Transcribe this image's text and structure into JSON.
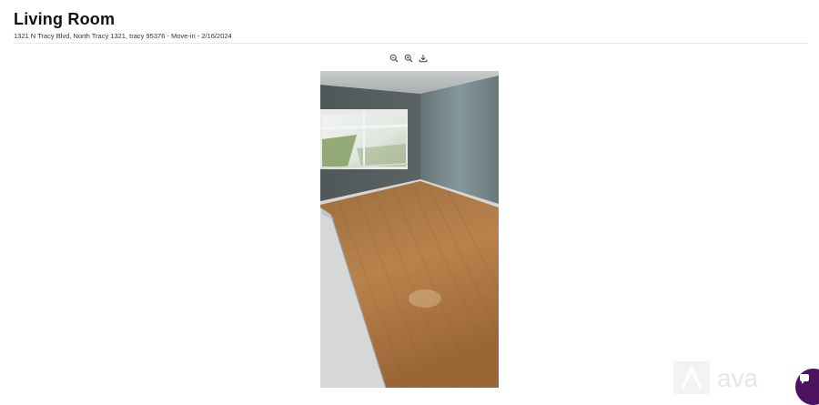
{
  "room": {
    "title": "Living Room",
    "subtitle": "1321 N Tracy Blvd, North Tracy 1321, tracy 95376 - Move-in - 2/16/2024"
  },
  "toolbar": {
    "icons": [
      "zoom-out-icon",
      "zoom-in-icon",
      "download-icon"
    ]
  },
  "photo": {
    "alt": "Empty living room with hardwood floor and window"
  },
  "watermark": {
    "logo": "ava"
  },
  "colors": {
    "chat_bubble": "#4b1360",
    "wall": "#5e6a6b",
    "floor": "#b07a45"
  }
}
